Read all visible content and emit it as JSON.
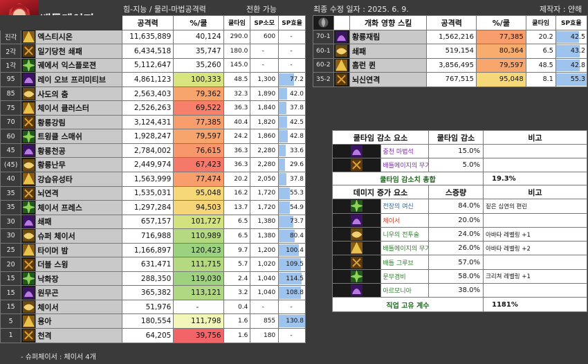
{
  "header": {
    "title": "배틀메이지",
    "stat_type": "힘-지능 / 물리-마법공격력",
    "switch": "전환 가능",
    "updated": "최종 수정 일자 : 2025. 6. 9.",
    "author": "제작자 : 얀해"
  },
  "main_table": {
    "headers": {
      "atk": "공격력",
      "pct": "%/쿨",
      "cd": "쿨타임",
      "sp": "SP소모",
      "eff": "SP효율"
    },
    "rows": [
      {
        "lv": "진각",
        "name": "엑스티시온",
        "atk": "11,635,889",
        "pct": "40,124",
        "cd": "290.0",
        "sp": "600",
        "eff": "-",
        "pct_color": "#ffffff",
        "eff_fill": 0
      },
      {
        "lv": "2각",
        "name": "일기당천 쇄패",
        "atk": "6,434,518",
        "pct": "35,747",
        "cd": "180.0",
        "sp": "-",
        "eff": "-",
        "pct_color": "#ffffff",
        "eff_fill": 0
      },
      {
        "lv": "1각",
        "name": "궤에서 익스플로젼",
        "atk": "5,112,647",
        "pct": "35,260",
        "cd": "145.0",
        "sp": "-",
        "eff": "-",
        "pct_color": "#ffffff",
        "eff_fill": 0
      },
      {
        "lv": "95",
        "name": "레이 오브 프리미티브",
        "atk": "4,861,123",
        "pct": "100,333",
        "cd": "48.5",
        "sp": "1,300",
        "eff": "77.2",
        "pct_color": "#d8e57e",
        "eff_fill": 0.59
      },
      {
        "lv": "85",
        "name": "사도의 춤",
        "atk": "2,563,403",
        "pct": "79,362",
        "cd": "32.3",
        "sp": "1,890",
        "eff": "42.0",
        "pct_color": "#f7a46d",
        "eff_fill": 0.32
      },
      {
        "lv": "75",
        "name": "체이서 클러스터",
        "atk": "2,526,263",
        "pct": "69,522",
        "cd": "36.3",
        "sp": "1,840",
        "eff": "37.8",
        "pct_color": "#f6806a",
        "eff_fill": 0.29
      },
      {
        "lv": "70",
        "name": "황룡강림",
        "atk": "3,124,431",
        "pct": "77,385",
        "cd": "40.4",
        "sp": "1,820",
        "eff": "42.5",
        "pct_color": "#f89d6c",
        "eff_fill": 0.32
      },
      {
        "lv": "60",
        "name": "트윙클 스매쉬",
        "atk": "1,928,247",
        "pct": "79,597",
        "cd": "24.2",
        "sp": "1,860",
        "eff": "42.8",
        "pct_color": "#f7a46d",
        "eff_fill": 0.33
      },
      {
        "lv": "45",
        "name": "황룡천공",
        "atk": "2,784,002",
        "pct": "76,615",
        "cd": "36.3",
        "sp": "2,280",
        "eff": "33.6",
        "pct_color": "#f8976b",
        "eff_fill": 0.26
      },
      {
        "lv": "(45)",
        "name": "황룡난무",
        "atk": "2,449,974",
        "pct": "67,423",
        "cd": "36.3",
        "sp": "2,280",
        "eff": "29.6",
        "pct_color": "#f57869",
        "eff_fill": 0.23
      },
      {
        "lv": "40",
        "name": "강습유성타",
        "atk": "1,563,999",
        "pct": "77,474",
        "cd": "20.2",
        "sp": "2,050",
        "eff": "37.8",
        "pct_color": "#f89d6c",
        "eff_fill": 0.29
      },
      {
        "lv": "35",
        "name": "뇌연격",
        "atk": "1,535,031",
        "pct": "95,048",
        "cd": "16.2",
        "sp": "1,720",
        "eff": "55.3",
        "pct_color": "#f6d878",
        "eff_fill": 0.42
      },
      {
        "lv": "35",
        "name": "체이서 프레스",
        "atk": "1,297,284",
        "pct": "94,503",
        "cd": "13.7",
        "sp": "1,720",
        "eff": "54.9",
        "pct_color": "#f6d578",
        "eff_fill": 0.42
      },
      {
        "lv": "30",
        "name": "쇄패",
        "atk": "657,157",
        "pct": "101,727",
        "cd": "6.5",
        "sp": "1,380",
        "eff": "73.7",
        "pct_color": "#d2e27e",
        "eff_fill": 0.56
      },
      {
        "lv": "30",
        "name": "슈퍼 체이서",
        "atk": "716,988",
        "pct": "110,989",
        "cd": "6.5",
        "sp": "1,380",
        "eff": "80.4",
        "pct_color": "#b5d981",
        "eff_fill": 0.61
      },
      {
        "lv": "25",
        "name": "타이머 밤",
        "atk": "1,166,897",
        "pct": "120,423",
        "cd": "9.7",
        "sp": "1,200",
        "eff": "100.4",
        "pct_color": "#9bd17f",
        "eff_fill": 0.77
      },
      {
        "lv": "20",
        "name": "더블 스윙",
        "atk": "631,471",
        "pct": "111,715",
        "cd": "5.7",
        "sp": "1,020",
        "eff": "109.5",
        "pct_color": "#b5d981",
        "eff_fill": 0.84
      },
      {
        "lv": "15",
        "name": "낙화장",
        "atk": "288,350",
        "pct": "119,030",
        "cd": "2.4",
        "sp": "1,040",
        "eff": "114.5",
        "pct_color": "#9fd27f",
        "eff_fill": 0.87
      },
      {
        "lv": "15",
        "name": "원무곤",
        "atk": "365,382",
        "pct": "113,121",
        "cd": "3.2",
        "sp": "1,040",
        "eff": "108.8",
        "pct_color": "#b0d781",
        "eff_fill": 0.83
      },
      {
        "lv": "15",
        "name": "체이서",
        "atk": "51,976",
        "pct": "-",
        "cd": "0.4",
        "sp": "-",
        "eff": "-",
        "pct_color": "#ffffff",
        "eff_fill": 0
      },
      {
        "lv": "5",
        "name": "용아",
        "atk": "180,554",
        "pct": "111,798",
        "cd": "1.6",
        "sp": "855",
        "eff": "130.8",
        "pct_color": "#f3f6b9",
        "eff_fill": 1.0
      },
      {
        "lv": "1",
        "name": "천격",
        "atk": "64,205",
        "pct": "39,756",
        "cd": "1.6",
        "sp": "180",
        "eff": "-",
        "pct_color": "#f26468",
        "eff_fill": 0
      }
    ]
  },
  "awakening_table": {
    "headers": {
      "name": "개화 영향 스킬",
      "atk": "공격력",
      "pct": "%/쿨",
      "cd": "쿨타임",
      "eff": "SP효율"
    },
    "rows": [
      {
        "lv": "70-1",
        "name": "황룡재림",
        "atk": "1,562,216",
        "pct": "77,385",
        "cd": "20.2",
        "eff": "42.5",
        "pct_color": "#f89d6c",
        "eff_fill": 0.76
      },
      {
        "lv": "60-1",
        "name": "쇄패",
        "atk": "519,154",
        "pct": "80,364",
        "cd": "6.5",
        "eff": "43.2",
        "pct_color": "#f8ad6f",
        "eff_fill": 0.78
      },
      {
        "lv": "60-2",
        "name": "홈런 퀸",
        "atk": "3,856,495",
        "pct": "79,597",
        "cd": "48.5",
        "eff": "42.8",
        "pct_color": "#f8a66e",
        "eff_fill": 0.77
      },
      {
        "lv": "35-2",
        "name": "뇌신연격",
        "atk": "767,515",
        "pct": "95,048",
        "cd": "8.1",
        "eff": "55.3",
        "pct_color": "#f6d878",
        "eff_fill": 1.0
      }
    ]
  },
  "cooldown_table": {
    "headers": {
      "name": "쿨타임 감소 요소",
      "val": "쿨타임 감소",
      "note": "비고"
    },
    "rows": [
      {
        "name": "중천 마법석",
        "val": "15.0%",
        "note": ""
      },
      {
        "name": "배틀메이지의 무기 마스터리",
        "val": "5.0%",
        "note": ""
      }
    ],
    "total_label": "쿨타임 감소치 총합",
    "total_value": "19.3%"
  },
  "damage_table": {
    "headers": {
      "name": "데미지 증가 요소",
      "val": "스증량",
      "note": "비고"
    },
    "rows": [
      {
        "name": "전장의 여신",
        "val": "84.0%",
        "note": "짙은 심연의 편린",
        "cls": "blue"
      },
      {
        "name": "체이서",
        "val": "20.0%",
        "note": "",
        "cls": "red"
      },
      {
        "name": "니우의 전투술",
        "val": "24.0%",
        "note": "아바타 레벨링 +1",
        "cls": "green"
      },
      {
        "name": "배틀메이지의 무기 마스터리",
        "val": "26.0%",
        "note": "아바타 레벨링 +2",
        "cls": "green"
      },
      {
        "name": "배틀 그루브",
        "val": "57.0%",
        "note": "",
        "cls": "green"
      },
      {
        "name": "문무겸비",
        "val": "58.0%",
        "note": "크리쳐 레벨링 +1",
        "cls": "green"
      },
      {
        "name": "아르모니아",
        "val": "38.0%",
        "note": "",
        "cls": "green"
      }
    ],
    "total_label": "직업 고유 계수",
    "total_value": "1181%"
  },
  "footnote": "- 슈퍼체이서 : 체이서 4개"
}
